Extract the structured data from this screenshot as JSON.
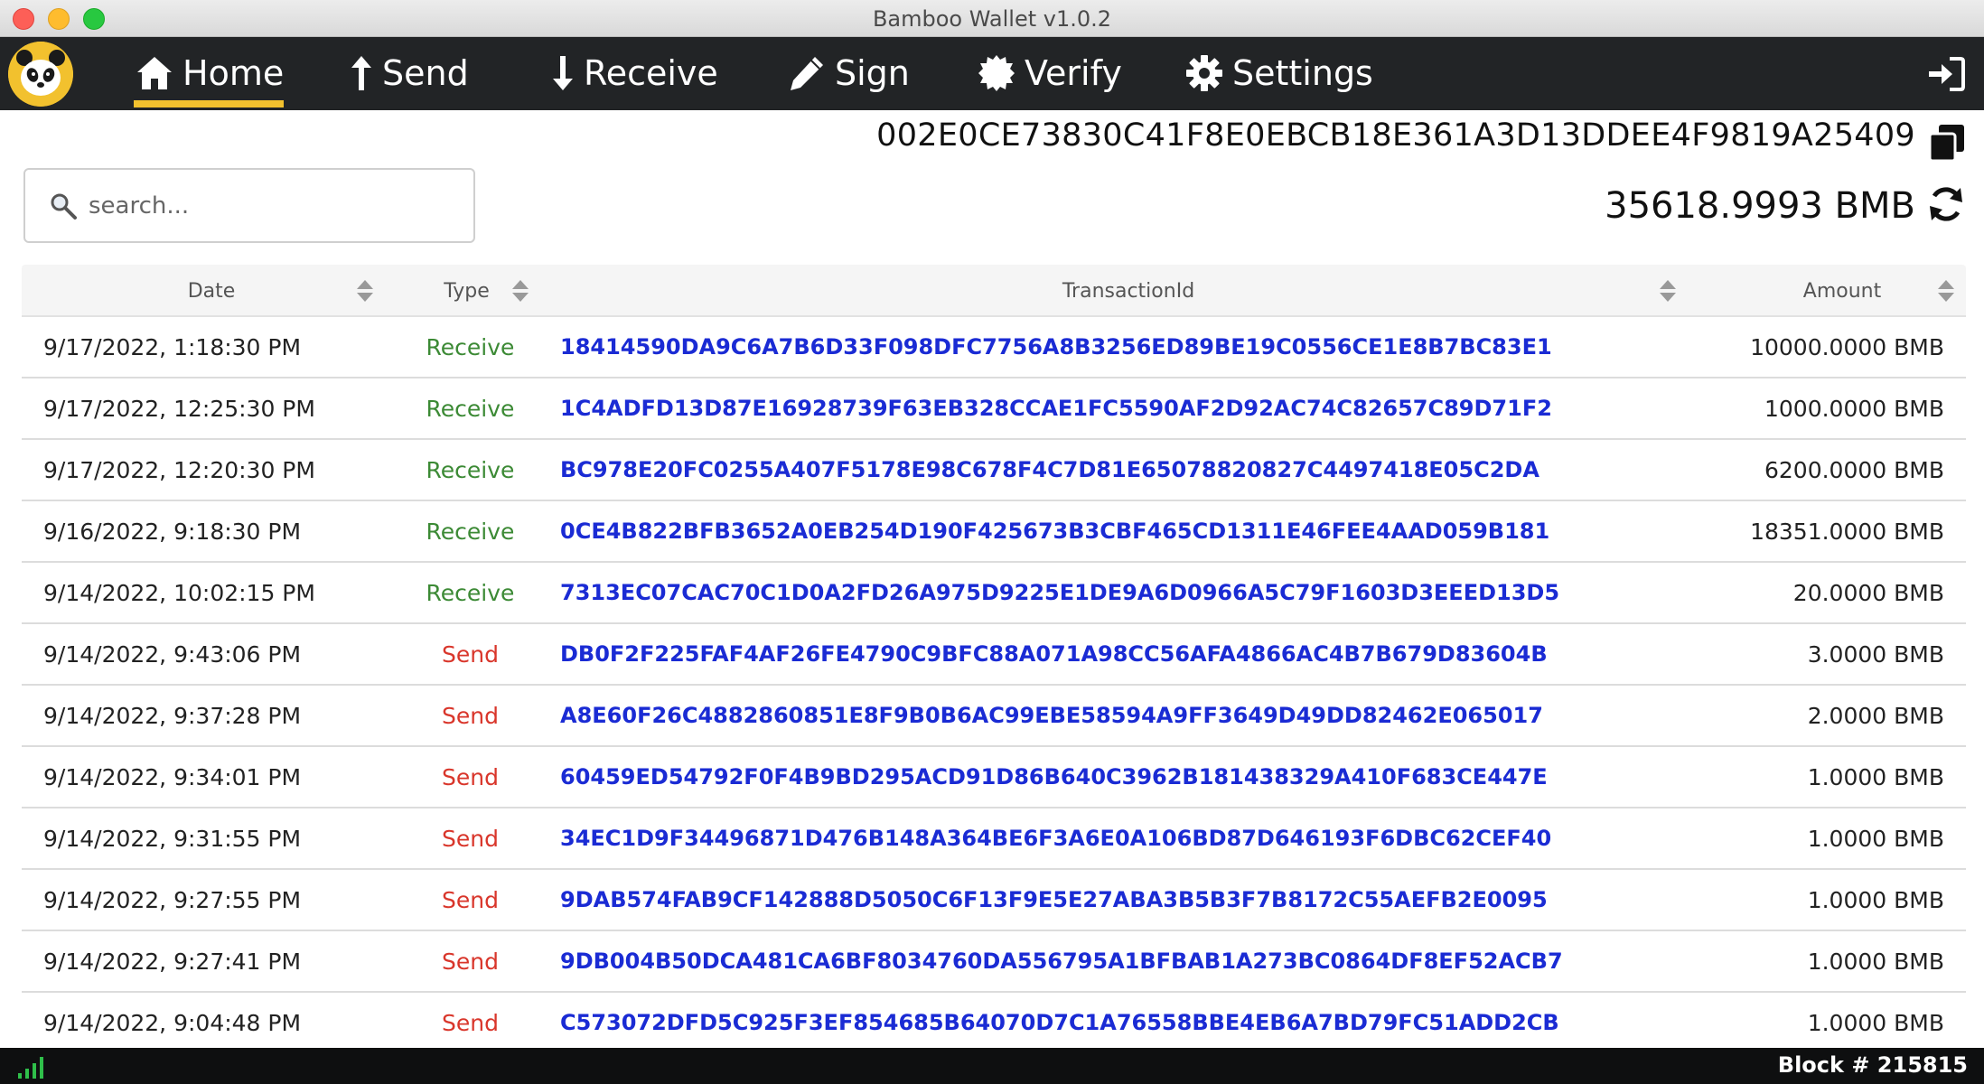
{
  "window": {
    "title": "Bamboo Wallet v1.0.2"
  },
  "nav": {
    "items": [
      {
        "label": "Home",
        "icon": "home-icon",
        "active": true
      },
      {
        "label": "Send",
        "icon": "arrow-up-icon",
        "active": false
      },
      {
        "label": "Receive",
        "icon": "arrow-down-icon",
        "active": false
      },
      {
        "label": "Sign",
        "icon": "pencil-icon",
        "active": false
      },
      {
        "label": "Verify",
        "icon": "certificate-icon",
        "active": false
      },
      {
        "label": "Settings",
        "icon": "gear-icon",
        "active": false
      }
    ],
    "accent_color": "#f2c12e"
  },
  "wallet": {
    "address": "002E0CE73830C41F8E0EBCB18E361A3D13DDEE4F9819A25409",
    "balance": "35618.9993 BMB"
  },
  "search": {
    "placeholder": "search..."
  },
  "table": {
    "columns": [
      "Date",
      "Type",
      "TransactionId",
      "Amount"
    ],
    "rows": [
      {
        "date": "9/17/2022, 1:18:30 PM",
        "type": "Receive",
        "txid": "18414590DA9C6A7B6D33F098DFC7756A8B3256ED89BE19C0556CE1E8B7BC83E1",
        "amount": "10000.0000 BMB"
      },
      {
        "date": "9/17/2022, 12:25:30 PM",
        "type": "Receive",
        "txid": "1C4ADFD13D87E16928739F63EB328CCAE1FC5590AF2D92AC74C82657C89D71F2",
        "amount": "1000.0000 BMB"
      },
      {
        "date": "9/17/2022, 12:20:30 PM",
        "type": "Receive",
        "txid": "BC978E20FC0255A407F5178E98C678F4C7D81E65078820827C4497418E05C2DA",
        "amount": "6200.0000 BMB"
      },
      {
        "date": "9/16/2022, 9:18:30 PM",
        "type": "Receive",
        "txid": "0CE4B822BFB3652A0EB254D190F425673B3CBF465CD1311E46FEE4AAD059B181",
        "amount": "18351.0000 BMB"
      },
      {
        "date": "9/14/2022, 10:02:15 PM",
        "type": "Receive",
        "txid": "7313EC07CAC70C1D0A2FD26A975D9225E1DE9A6D0966A5C79F1603D3EEED13D5",
        "amount": "20.0000 BMB"
      },
      {
        "date": "9/14/2022, 9:43:06 PM",
        "type": "Send",
        "txid": "DB0F2F225FAF4AF26FE4790C9BFC88A071A98CC56AFA4866AC4B7B679D83604B",
        "amount": "3.0000 BMB"
      },
      {
        "date": "9/14/2022, 9:37:28 PM",
        "type": "Send",
        "txid": "A8E60F26C4882860851E8F9B0B6AC99EBE58594A9FF3649D49DD82462E065017",
        "amount": "2.0000 BMB"
      },
      {
        "date": "9/14/2022, 9:34:01 PM",
        "type": "Send",
        "txid": "60459ED54792F0F4B9BD295ACD91D86B640C3962B181438329A410F683CE447E",
        "amount": "1.0000 BMB"
      },
      {
        "date": "9/14/2022, 9:31:55 PM",
        "type": "Send",
        "txid": "34EC1D9F34496871D476B148A364BE6F3A6E0A106BD87D646193F6DBC62CEF40",
        "amount": "1.0000 BMB"
      },
      {
        "date": "9/14/2022, 9:27:55 PM",
        "type": "Send",
        "txid": "9DAB574FAB9CF142888D5050C6F13F9E5E27ABA3B5B3F7B8172C55AEFB2E0095",
        "amount": "1.0000 BMB"
      },
      {
        "date": "9/14/2022, 9:27:41 PM",
        "type": "Send",
        "txid": "9DB004B50DCA481CA6BF8034760DA556795A1BFBAB1A273BC0864DF8EF52ACB7",
        "amount": "1.0000 BMB"
      },
      {
        "date": "9/14/2022, 9:04:48 PM",
        "type": "Send",
        "txid": "C573072DFD5C925F3EF854685B64070D7C1A76558BBE4EB6A7BD79FC51ADD2CB",
        "amount": "1.0000 BMB"
      }
    ]
  },
  "status": {
    "block": "Block # 215815"
  }
}
